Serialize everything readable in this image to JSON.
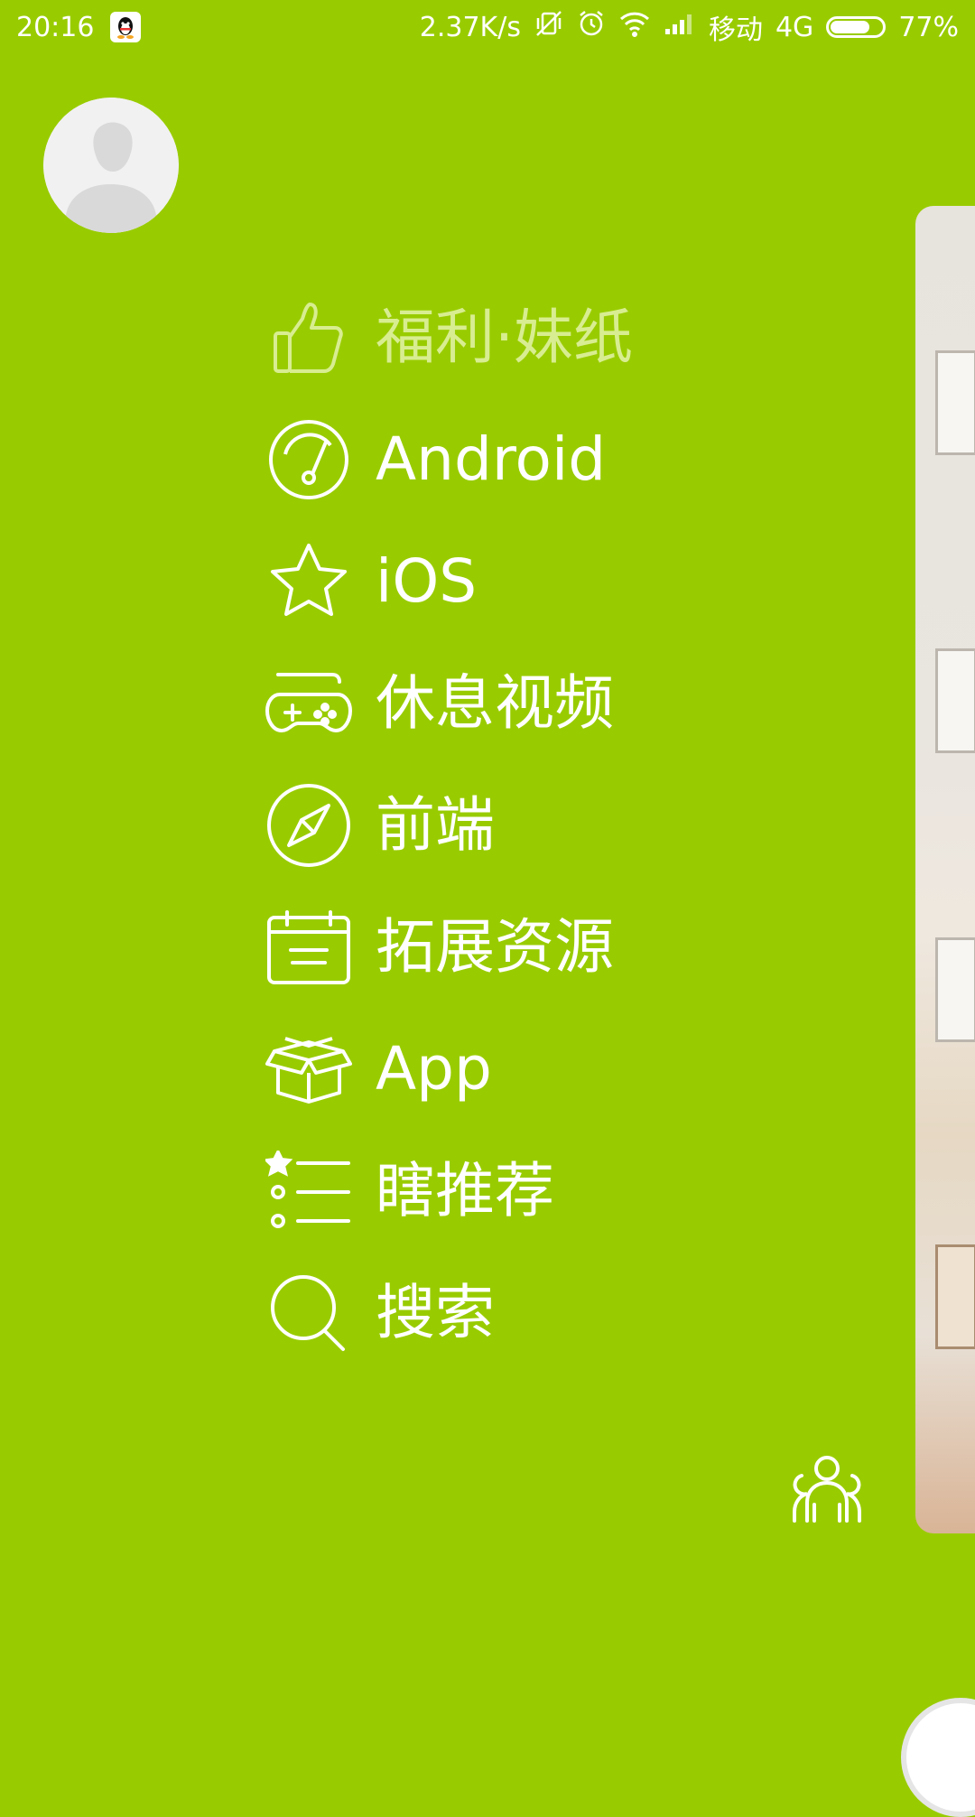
{
  "status_bar": {
    "time": "20:16",
    "speed": "2.37K/s",
    "carrier": "移动",
    "network": "4G",
    "battery_percent": "77%",
    "battery_level": 0.77
  },
  "drawer": {
    "menu": [
      {
        "label": "福利·妹纸",
        "icon": "thumbs-up-icon",
        "active": true
      },
      {
        "label": "Android",
        "icon": "speedometer-icon",
        "active": false
      },
      {
        "label": "iOS",
        "icon": "star-icon",
        "active": false
      },
      {
        "label": "休息视频",
        "icon": "gamepad-icon",
        "active": false
      },
      {
        "label": "前端",
        "icon": "compass-icon",
        "active": false
      },
      {
        "label": "拓展资源",
        "icon": "calendar-icon",
        "active": false
      },
      {
        "label": "App",
        "icon": "box-icon",
        "active": false
      },
      {
        "label": "瞎推荐",
        "icon": "list-icon",
        "active": false
      },
      {
        "label": "搜索",
        "icon": "search-icon",
        "active": false
      }
    ]
  },
  "colors": {
    "background": "#99CC00",
    "active_text": "#d8ed91",
    "text": "#ffffff"
  }
}
